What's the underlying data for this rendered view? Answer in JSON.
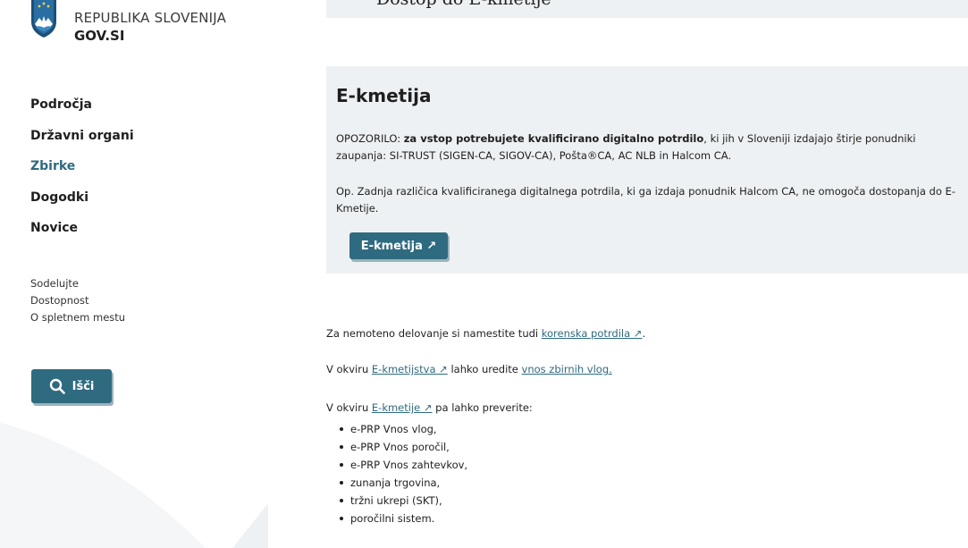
{
  "header": {
    "logo_line1": "REPUBLIKA SLOVENIJA",
    "logo_line2": "GOV.SI",
    "top_band_text": "Dostop do E-kmetije"
  },
  "sidebar": {
    "main_nav": [
      {
        "label": "Področja"
      },
      {
        "label": "Državni organi"
      },
      {
        "label": "Zbirke",
        "active": true
      },
      {
        "label": "Dogodki"
      },
      {
        "label": "Novice"
      }
    ],
    "sub_nav": [
      {
        "label": "Sodelujte"
      },
      {
        "label": "Dostopnost"
      },
      {
        "label": "O spletnem mestu"
      }
    ],
    "search_label": "Išči"
  },
  "ekmetija_box": {
    "title": "E-kmetija",
    "warning_prefix": "OPOZORILO: ",
    "warning_bold": "za vstop potrebujete kvalificirano digitalno potrdilo",
    "warning_rest": ", ki jih v Sloveniji izdajajo štirje ponudniki zaupanja: SI-TRUST (SIGEN-CA, SIGOV-CA), Pošta®CA, AC NLB in Halcom CA.",
    "note": "Op. Zadnja različica kvalificiranega digitalnega potrdila, ki ga izdaja ponudnik Halcom CA, ne omogoča dostopanja do E-Kmetije.",
    "button_label": "E-kmetija ↗"
  },
  "body": {
    "p1_prefix": "Za nemoteno delovanje si namestite tudi ",
    "p1_link": "korenska potrdila ↗",
    "p1_suffix": ".",
    "p2_prefix": "V okviru ",
    "p2_link1": "E-kmetijstva ↗",
    "p2_middle": " lahko uredite ",
    "p2_link2": "vnos zbirnih vlog.",
    "p3_prefix": "V okviru ",
    "p3_link": "E-kmetije ↗",
    "p3_suffix": " pa lahko preverite:",
    "items": [
      "e-PRP Vnos vlog,",
      "e-PRP Vnos poročil,",
      "e-PRP Vnos zahtevkov,",
      "zunanja trgovina,",
      "tržni ukrepi (SKT),",
      "poročilni sistem."
    ]
  },
  "colors": {
    "accent": "#2f6b80",
    "panel": "#eef1f3",
    "text": "#1f1f1f"
  },
  "icons": [
    "slovenia-coat-of-arms-icon",
    "search-icon",
    "external-link-icon"
  ]
}
